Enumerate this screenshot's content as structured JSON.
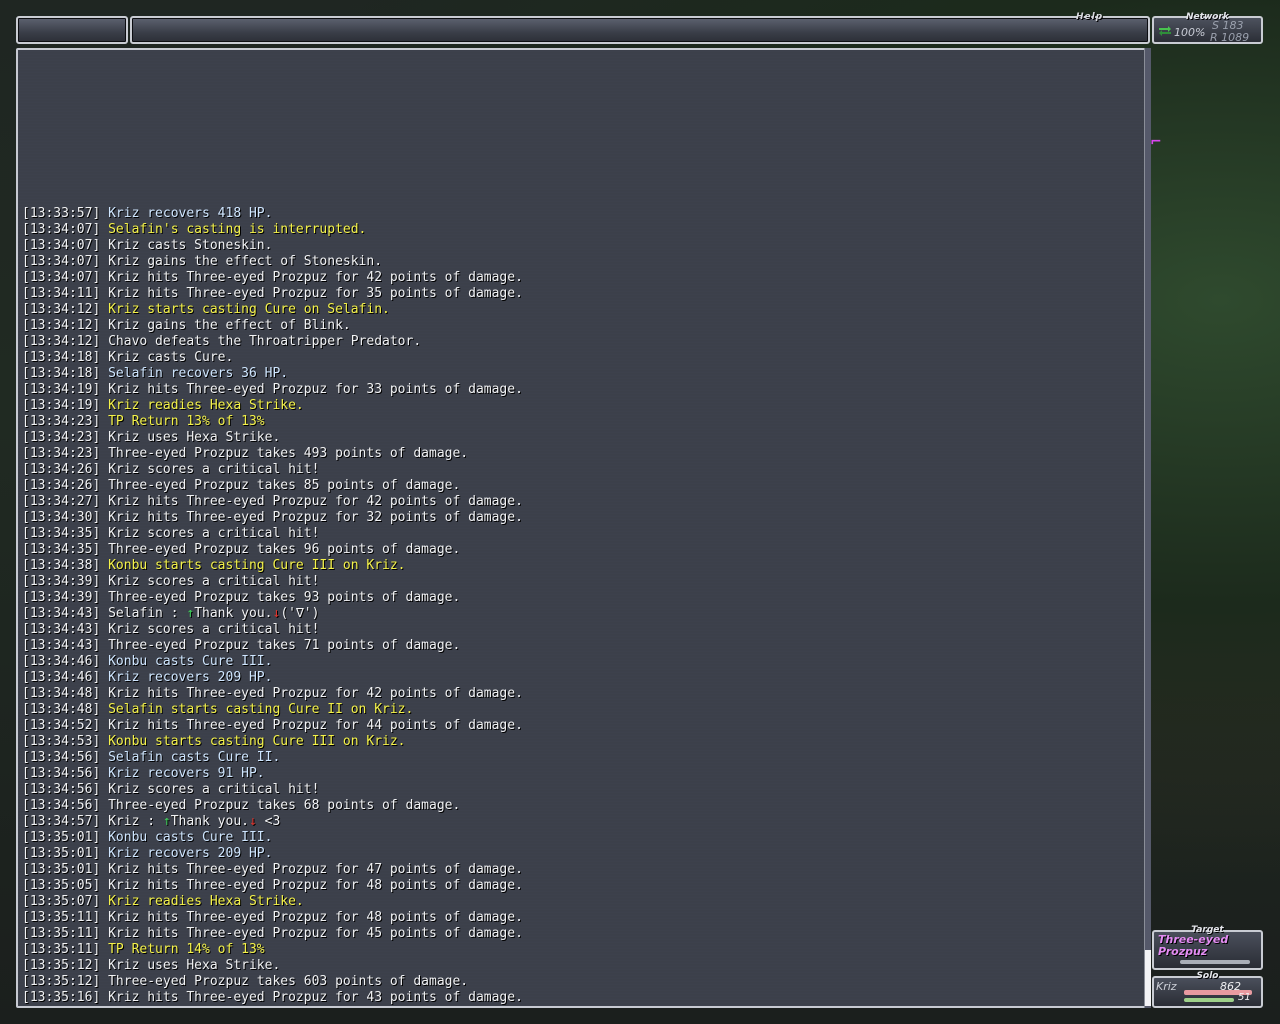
{
  "header": {
    "help_label": "Help"
  },
  "network": {
    "title": "Network",
    "percent": "100%",
    "send": "S 183",
    "receive": "R 1089"
  },
  "target": {
    "title": "Target",
    "name": "Three-eyed Prozpuz"
  },
  "solo": {
    "title": "Solo",
    "name": "Kriz",
    "hp": "862",
    "mp": "51"
  },
  "colors": {
    "white": "#f1f2f4",
    "yellow": "#f4f24a",
    "lightblue": "#cfe6ff",
    "target_pink": "#e48cf3"
  },
  "chat_log": [
    {
      "t": "[13:33:57]",
      "text": "Kriz recovers 418 HP.",
      "color": "lightblue"
    },
    {
      "t": "[13:34:07]",
      "text": "Selafin's casting is interrupted.",
      "color": "yellow"
    },
    {
      "t": "[13:34:07]",
      "text": "Kriz casts Stoneskin.",
      "color": "white"
    },
    {
      "t": "[13:34:07]",
      "text": "Kriz gains the effect of Stoneskin.",
      "color": "white"
    },
    {
      "t": "[13:34:07]",
      "text": "Kriz hits Three-eyed Prozpuz for 42 points of damage.",
      "color": "white"
    },
    {
      "t": "[13:34:11]",
      "text": "Kriz hits Three-eyed Prozpuz for 35 points of damage.",
      "color": "white"
    },
    {
      "t": "[13:34:12]",
      "text": "Kriz starts casting Cure on Selafin.",
      "color": "yellow"
    },
    {
      "t": "[13:34:12]",
      "text": "Kriz gains the effect of Blink.",
      "color": "white"
    },
    {
      "t": "[13:34:12]",
      "text": "Chavo defeats the Throatripper Predator.",
      "color": "white"
    },
    {
      "t": "[13:34:18]",
      "text": "Kriz casts Cure.",
      "color": "white"
    },
    {
      "t": "[13:34:18]",
      "text": "Selafin recovers 36 HP.",
      "color": "lightblue"
    },
    {
      "t": "[13:34:19]",
      "text": "Kriz hits Three-eyed Prozpuz for 33 points of damage.",
      "color": "white"
    },
    {
      "t": "[13:34:19]",
      "text": "Kriz readies Hexa Strike.",
      "color": "yellow"
    },
    {
      "t": "[13:34:23]",
      "text": "TP Return 13% of 13%",
      "color": "yellow"
    },
    {
      "t": "[13:34:23]",
      "text": "Kriz uses Hexa Strike.",
      "color": "white"
    },
    {
      "t": "[13:34:23]",
      "text": "Three-eyed Prozpuz takes 493 points of damage.",
      "color": "white"
    },
    {
      "t": "[13:34:26]",
      "text": "Kriz scores a critical hit!",
      "color": "white"
    },
    {
      "t": "[13:34:26]",
      "text": "Three-eyed Prozpuz takes 85 points of damage.",
      "color": "white"
    },
    {
      "t": "[13:34:27]",
      "text": "Kriz hits Three-eyed Prozpuz for 42 points of damage.",
      "color": "white"
    },
    {
      "t": "[13:34:30]",
      "text": "Kriz hits Three-eyed Prozpuz for 32 points of damage.",
      "color": "white"
    },
    {
      "t": "[13:34:35]",
      "text": "Kriz scores a critical hit!",
      "color": "white"
    },
    {
      "t": "[13:34:35]",
      "text": "Three-eyed Prozpuz takes 96 points of damage.",
      "color": "white"
    },
    {
      "t": "[13:34:38]",
      "text": "Konbu starts casting Cure III on Kriz.",
      "color": "yellow"
    },
    {
      "t": "[13:34:39]",
      "text": "Kriz scores a critical hit!",
      "color": "white"
    },
    {
      "t": "[13:34:39]",
      "text": "Three-eyed Prozpuz takes 93 points of damage.",
      "color": "white"
    },
    {
      "t": "[13:34:43]",
      "text": "Selafin : ↑Thank you.↓('∇')",
      "color": "white",
      "chat": true,
      "speaker": "Selafin : ",
      "msg": "Thank you.",
      "tail": "('∇')"
    },
    {
      "t": "[13:34:43]",
      "text": "Kriz scores a critical hit!",
      "color": "white"
    },
    {
      "t": "[13:34:43]",
      "text": "Three-eyed Prozpuz takes 71 points of damage.",
      "color": "white"
    },
    {
      "t": "[13:34:46]",
      "text": "Konbu casts Cure III.",
      "color": "lightblue"
    },
    {
      "t": "[13:34:46]",
      "text": "Kriz recovers 209 HP.",
      "color": "lightblue"
    },
    {
      "t": "[13:34:48]",
      "text": "Kriz hits Three-eyed Prozpuz for 42 points of damage.",
      "color": "white"
    },
    {
      "t": "[13:34:48]",
      "text": "Selafin starts casting Cure II on Kriz.",
      "color": "yellow"
    },
    {
      "t": "[13:34:52]",
      "text": "Kriz hits Three-eyed Prozpuz for 44 points of damage.",
      "color": "white"
    },
    {
      "t": "[13:34:53]",
      "text": "Konbu starts casting Cure III on Kriz.",
      "color": "yellow"
    },
    {
      "t": "[13:34:56]",
      "text": "Selafin casts Cure II.",
      "color": "lightblue"
    },
    {
      "t": "[13:34:56]",
      "text": "Kriz recovers 91 HP.",
      "color": "lightblue"
    },
    {
      "t": "[13:34:56]",
      "text": "Kriz scores a critical hit!",
      "color": "white"
    },
    {
      "t": "[13:34:56]",
      "text": "Three-eyed Prozpuz takes 68 points of damage.",
      "color": "white"
    },
    {
      "t": "[13:34:57]",
      "text": "Kriz : ↑Thank you.↓ <3",
      "color": "white",
      "chat": true,
      "speaker": "Kriz : ",
      "msg": "Thank you.",
      "tail": " <3"
    },
    {
      "t": "[13:35:01]",
      "text": "Konbu casts Cure III.",
      "color": "lightblue"
    },
    {
      "t": "[13:35:01]",
      "text": "Kriz recovers 209 HP.",
      "color": "lightblue"
    },
    {
      "t": "[13:35:01]",
      "text": "Kriz hits Three-eyed Prozpuz for 47 points of damage.",
      "color": "white"
    },
    {
      "t": "[13:35:05]",
      "text": "Kriz hits Three-eyed Prozpuz for 48 points of damage.",
      "color": "white"
    },
    {
      "t": "[13:35:07]",
      "text": "Kriz readies Hexa Strike.",
      "color": "yellow"
    },
    {
      "t": "[13:35:11]",
      "text": "Kriz hits Three-eyed Prozpuz for 48 points of damage.",
      "color": "white"
    },
    {
      "t": "[13:35:11]",
      "text": "Kriz hits Three-eyed Prozpuz for 45 points of damage.",
      "color": "white"
    },
    {
      "t": "[13:35:11]",
      "text": "TP Return 14% of 13%",
      "color": "yellow"
    },
    {
      "t": "[13:35:12]",
      "text": "Kriz uses Hexa Strike.",
      "color": "white"
    },
    {
      "t": "[13:35:12]",
      "text": "Three-eyed Prozpuz takes 603 points of damage.",
      "color": "white"
    },
    {
      "t": "[13:35:16]",
      "text": "Kriz hits Three-eyed Prozpuz for 43 points of damage.",
      "color": "white"
    }
  ]
}
